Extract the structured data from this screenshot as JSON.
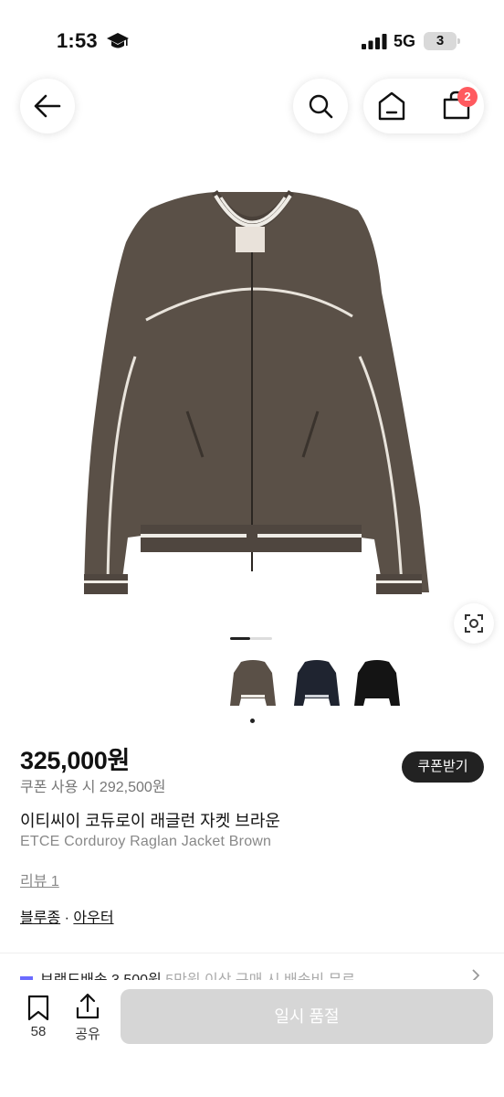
{
  "status_bar": {
    "time": "1:53",
    "network": "5G",
    "battery": "3"
  },
  "nav": {
    "cart_count": "2"
  },
  "gallery": {
    "pager_active_fraction": 0.5,
    "thumbnails": [
      "brown",
      "navy",
      "black"
    ]
  },
  "product": {
    "price": "325,000원",
    "coupon_price": "쿠폰 사용 시 292,500원",
    "coupon_button": "쿠폰받기",
    "title_ko": "이티씨이 코듀로이 래글런 자켓 브라운",
    "title_en": "ETCE Corduroy Raglan Jacket Brown",
    "review_link": "리뷰 1",
    "category_1": "블루종",
    "category_sep": " · ",
    "category_2": "아우터"
  },
  "promo": {
    "text": "브랜드배송 3,500원",
    "detail": "5만원 이상 구매 시 배송비 무료"
  },
  "bottom_bar": {
    "bookmark_count": "58",
    "share_label": "공유",
    "soldout_label": "일시 품절"
  },
  "colors": {
    "badge": "#ff5a5f",
    "coupon_button_bg": "#222222",
    "soldout_bg": "#d6d6d6",
    "jacket_brown": "#5a5047"
  }
}
